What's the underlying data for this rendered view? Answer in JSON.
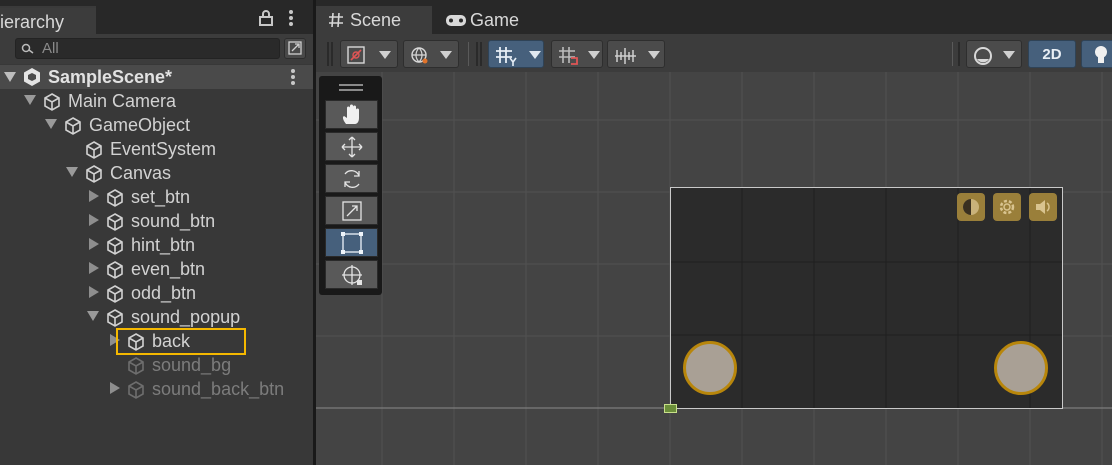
{
  "hierarchy": {
    "tab_label": "ierarchy",
    "search_placeholder": "All",
    "scene_name": "SampleScene*",
    "items": [
      {
        "label": "Main Camera"
      },
      {
        "label": "GameObject"
      },
      {
        "label": "EventSystem"
      },
      {
        "label": "Canvas"
      },
      {
        "label": "set_btn"
      },
      {
        "label": "sound_btn"
      },
      {
        "label": "hint_btn"
      },
      {
        "label": "even_btn"
      },
      {
        "label": "odd_btn"
      },
      {
        "label": "sound_popup"
      },
      {
        "label": "back"
      },
      {
        "label": "sound_bg"
      },
      {
        "label": "sound_back_btn"
      }
    ]
  },
  "scene": {
    "tabs": [
      {
        "label": "Scene"
      },
      {
        "label": "Game"
      }
    ],
    "toggle_2d": "2D"
  },
  "colors": {
    "accent_blue": "#46607c",
    "selection_outline": "#f5b800",
    "gold": "#b8860b"
  }
}
